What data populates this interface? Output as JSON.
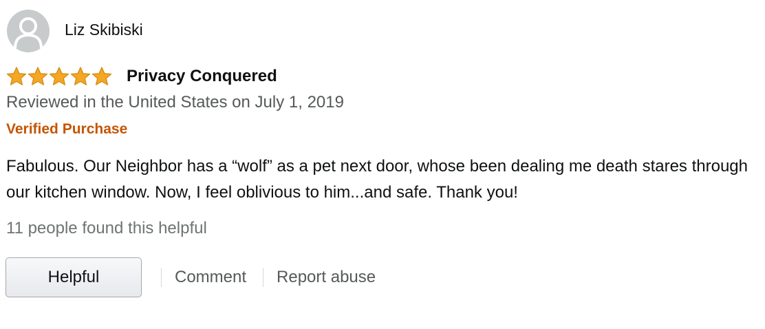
{
  "reviewer": {
    "name": "Liz Skibiski",
    "avatar_icon": "default-profile-icon"
  },
  "rating": {
    "stars": 5,
    "max": 5,
    "star_color": "#f5a623"
  },
  "review": {
    "title": "Privacy Conquered",
    "date_text": "Reviewed in the United States on July 1, 2019",
    "verified_label": "Verified Purchase",
    "verified_color": "#c45500",
    "body": "Fabulous. Our Neighbor has a “wolf” as a pet next door, whose been dealing me death stares through our kitchen window. Now, I feel oblivious to him...and safe. Thank you!"
  },
  "helpfulness": {
    "count_text": "11 people found this helpful"
  },
  "actions": {
    "helpful_label": "Helpful",
    "comment_label": "Comment",
    "report_label": "Report abuse"
  }
}
